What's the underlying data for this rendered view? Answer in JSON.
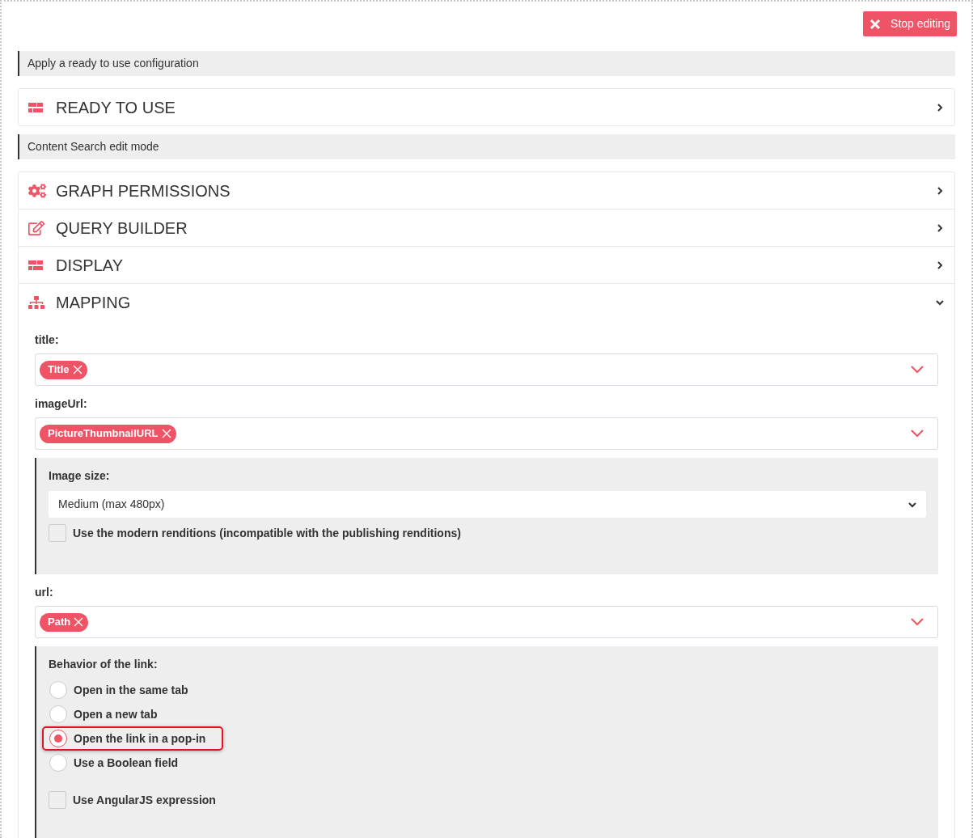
{
  "toolbar": {
    "stop_button": "Stop editing"
  },
  "sections": [
    {
      "heading": "Apply a ready to use configuration",
      "panels": [
        {
          "title": "READY TO USE",
          "expanded": false
        }
      ]
    },
    {
      "heading": "Content Search edit mode",
      "panels": [
        {
          "title": "GRAPH PERMISSIONS",
          "expanded": false
        },
        {
          "title": "QUERY BUILDER",
          "expanded": false
        },
        {
          "title": "DISPLAY",
          "expanded": false
        },
        {
          "title": "MAPPING",
          "expanded": true,
          "fields": [
            {
              "label": "title:",
              "tags": [
                "Title"
              ]
            },
            {
              "label": "imageUrl:",
              "tags": [
                "PictureThumbnailURL"
              ],
              "options": {
                "kind": "select",
                "label": "Image size:",
                "value": "Medium (max 480px)",
                "checkbox": {
                  "label": "Use the modern renditions (incompatible with the publishing renditions)",
                  "checked": false
                }
              }
            },
            {
              "label": "url:",
              "tags": [
                "Path"
              ],
              "options": {
                "kind": "radio",
                "label": "Behavior of the link:",
                "choices": [
                  {
                    "label": "Open in the same tab",
                    "selected": false,
                    "highlighted": false
                  },
                  {
                    "label": "Open a new tab",
                    "selected": false,
                    "highlighted": false
                  },
                  {
                    "label": "Open the link in a pop-in",
                    "selected": true,
                    "highlighted": true
                  },
                  {
                    "label": "Use a Boolean field",
                    "selected": false,
                    "highlighted": false
                  }
                ],
                "checkbox": {
                  "label": "Use AngularJS expression",
                  "checked": false
                }
              }
            }
          ]
        }
      ]
    }
  ]
}
